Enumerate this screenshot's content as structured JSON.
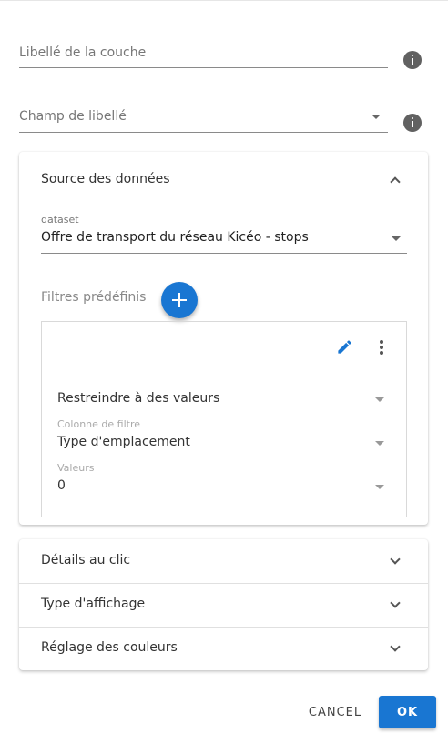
{
  "fields": {
    "layer_label": {
      "placeholder": "Libellé de la couche"
    },
    "label_field": {
      "placeholder": "Champ de libellé"
    }
  },
  "data_source": {
    "title": "Source des données",
    "expanded": true,
    "dataset_label": "dataset",
    "dataset_value": "Offre de transport du réseau Kicéo - stops",
    "filters_label": "Filtres prédéfinis",
    "filter": {
      "mode_value": "Restreindre à des valeurs",
      "column_label": "Colonne de filtre",
      "column_value": "Type d'emplacement",
      "values_label": "Valeurs",
      "values_value": "0"
    }
  },
  "panels": [
    {
      "title": "Détails au clic"
    },
    {
      "title": "Type d'affichage"
    },
    {
      "title": "Réglage des couleurs"
    }
  ],
  "actions": {
    "cancel_label": "CANCEL",
    "ok_label": "OK"
  },
  "colors": {
    "accent": "#1976d2",
    "info_icon": "#616161"
  },
  "icons": [
    "info-icon",
    "chevron-up-icon",
    "chevron-down-icon",
    "plus-icon",
    "pencil-icon",
    "more-vert-icon",
    "dropdown-caret-icon"
  ]
}
